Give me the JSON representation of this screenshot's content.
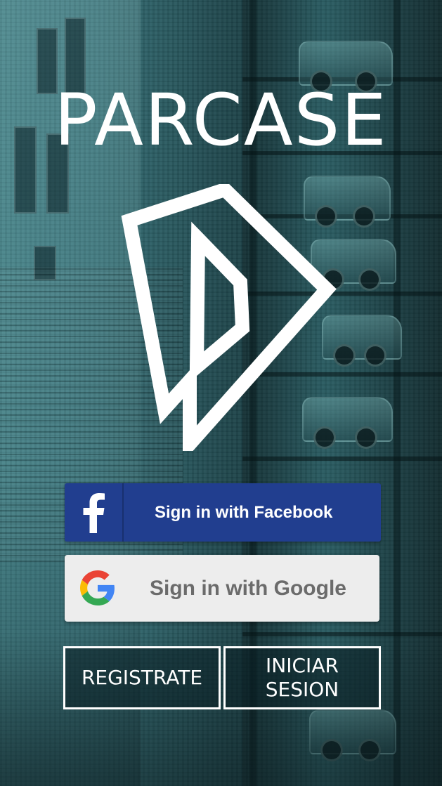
{
  "app": {
    "title": "PARCASE"
  },
  "buttons": {
    "facebook_label": "Sign in with Facebook",
    "google_label": "Sign in with Google",
    "register_label": "REGISTRATE",
    "login_label": "INICIAR SESION"
  },
  "icons": {
    "facebook": "facebook-icon",
    "google": "google-icon",
    "logo": "parcase-logo"
  },
  "colors": {
    "facebook_blue": "#213e8f",
    "google_bg": "#ededed",
    "accent_white": "#ffffff",
    "background_teal": "#2a5a60"
  }
}
